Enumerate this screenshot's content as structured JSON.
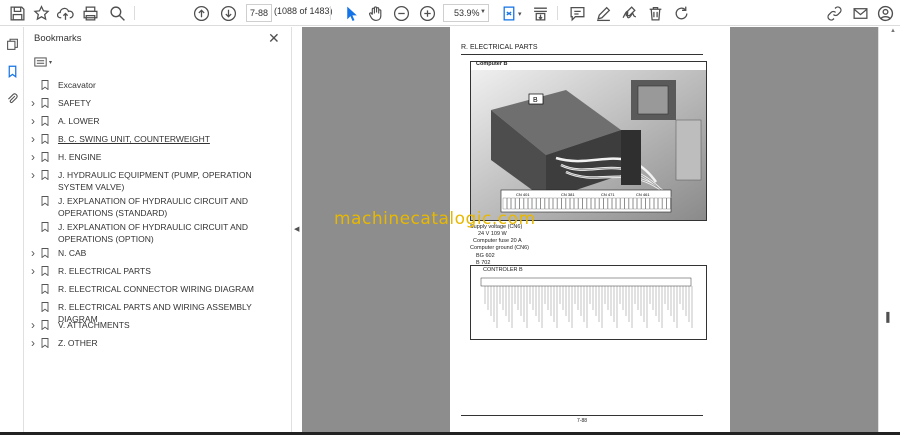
{
  "toolbar": {
    "page_current": "7-88",
    "page_count": "(1088 of 1483)",
    "zoom": "53.9%",
    "icons": [
      "save-icon",
      "bookmark-star-icon",
      "upload-icon",
      "print-icon",
      "zoom-search-icon",
      "prev-page-icon",
      "next-page-icon",
      "select-cursor-icon",
      "hand-icon",
      "zoom-out-icon",
      "zoom-in-icon",
      "fit-page-icon",
      "scroll-mode-icon",
      "comment-icon",
      "highlight-pen-icon",
      "sign-icon",
      "delete-icon",
      "rotate-icon",
      "share-link-icon",
      "email-icon",
      "account-icon"
    ]
  },
  "panel": {
    "title": "Bookmarks",
    "items": [
      {
        "label": "Excavator",
        "expandable": false,
        "underlined": false
      },
      {
        "label": "SAFETY",
        "expandable": true,
        "underlined": false
      },
      {
        "label": "A. LOWER",
        "expandable": true,
        "underlined": false
      },
      {
        "label": "B. C. SWING UNIT, COUNTERWEIGHT",
        "expandable": true,
        "underlined": true
      },
      {
        "label": "H. ENGINE",
        "expandable": true,
        "underlined": false
      },
      {
        "label": "J. HYDRAULIC EQUIPMENT (PUMP, OPERATION SYSTEM VALVE)",
        "expandable": true,
        "underlined": false
      },
      {
        "label": "J. EXPLANATION OF HYDRAULIC CIRCUIT AND OPERATIONS (STANDARD)",
        "expandable": false,
        "underlined": false
      },
      {
        "label": "J. EXPLANATION OF HYDRAULIC CIRCUIT AND OPERATIONS (OPTION)",
        "expandable": false,
        "underlined": false
      },
      {
        "label": "N. CAB",
        "expandable": true,
        "underlined": false
      },
      {
        "label": "R. ELECTRICAL PARTS",
        "expandable": true,
        "underlined": false
      },
      {
        "label": "R. ELECTRICAL CONNECTOR WIRING DIAGRAM",
        "expandable": false,
        "underlined": false
      },
      {
        "label": "R. ELECTRICAL PARTS AND WIRING ASSEMBLY DIAGRAM",
        "expandable": false,
        "underlined": false
      },
      {
        "label": "V. ATTACHMENTS",
        "expandable": true,
        "underlined": false
      },
      {
        "label": "Z. OTHER",
        "expandable": true,
        "underlined": false
      }
    ]
  },
  "document": {
    "section_header": "R. ELECTRICAL PARTS",
    "photo_caption": "Computer B",
    "photo_tag": "B",
    "conn_labels": [
      "CN 401",
      "CN 381",
      "CN 471",
      "CN 461"
    ],
    "power_lines": [
      "Supply voltage (CN6)",
      "24 V  109 W",
      "Computer fuse 20 A",
      "Computer ground (CN6)",
      "BG 602",
      "B 702"
    ],
    "diagram_title": "CONTROLER B",
    "page_number": "7-88",
    "watermark": "machinecatalogic.com"
  }
}
